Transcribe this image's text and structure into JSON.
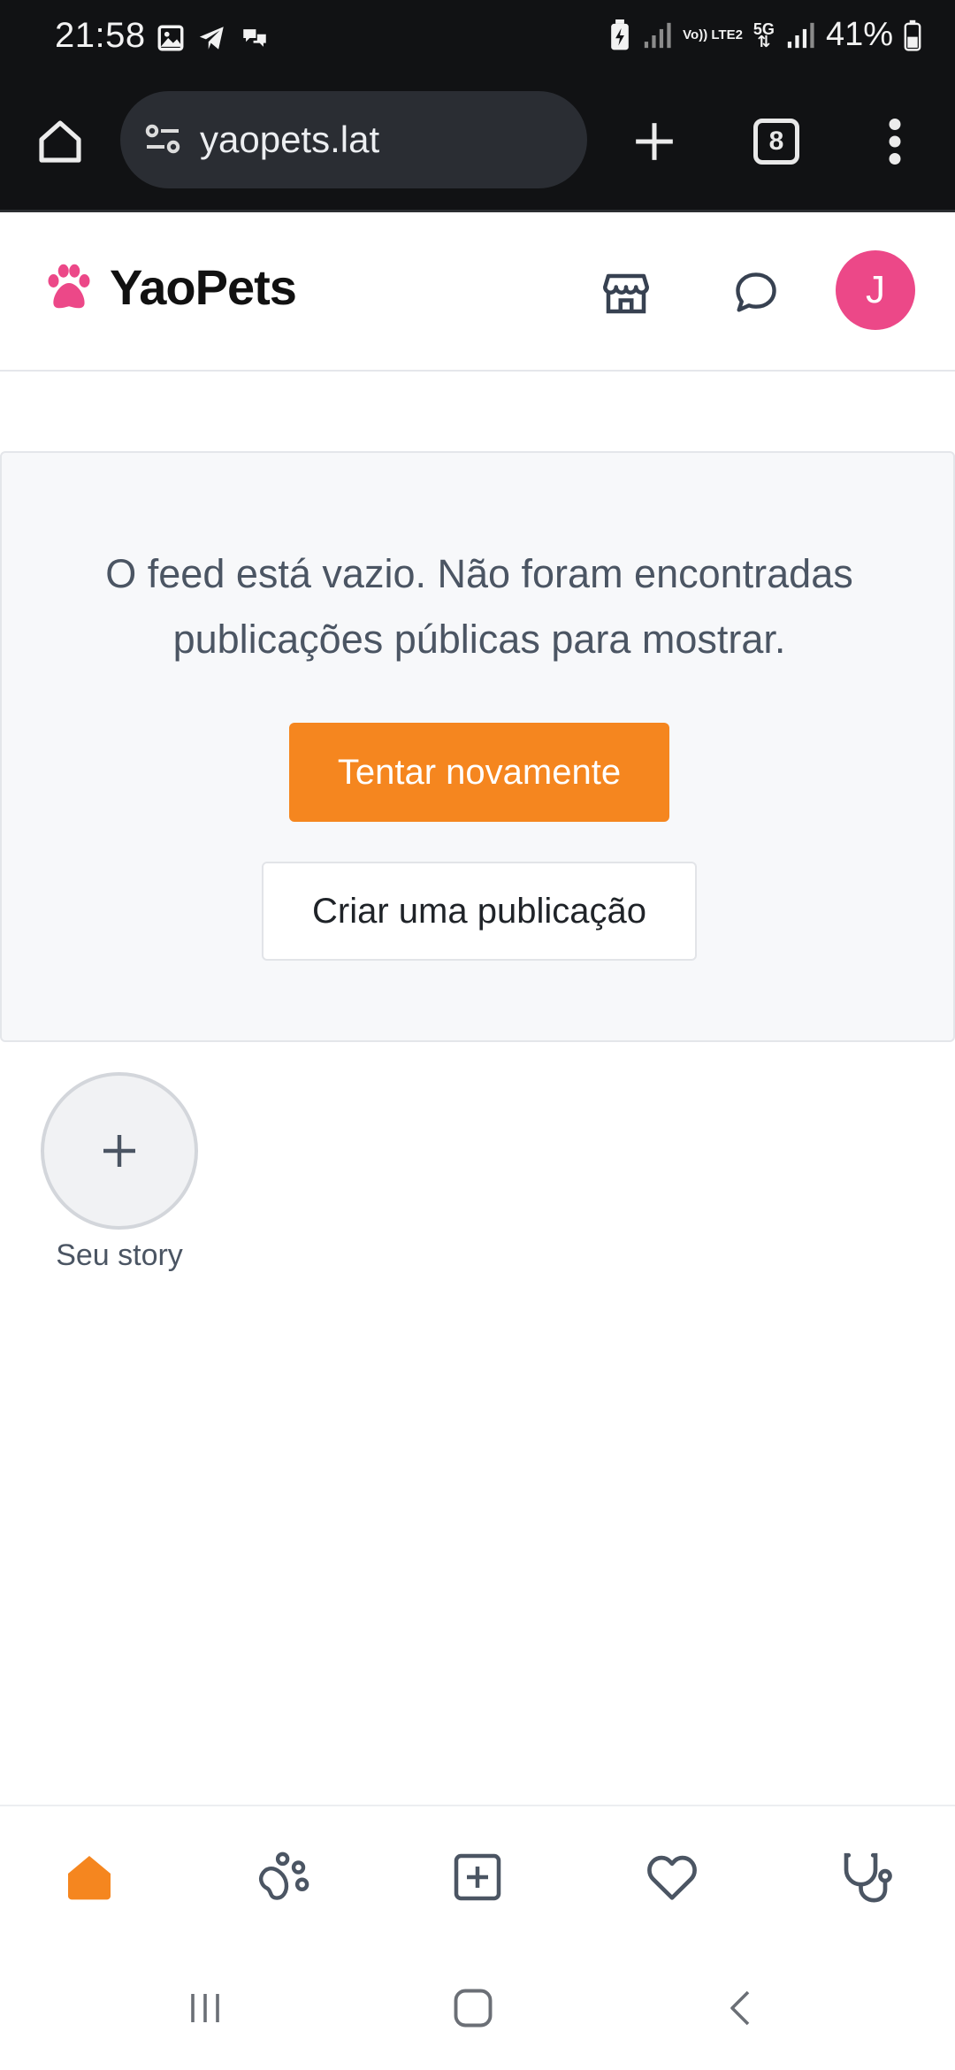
{
  "status_bar": {
    "time": "21:58",
    "network_lte": "Vo)) LTE2",
    "network_5g": "5G",
    "battery": "41%"
  },
  "browser": {
    "url": "yaopets.lat",
    "tab_count": "8"
  },
  "header": {
    "brand": "YaoPets",
    "avatar_initial": "J",
    "brand_color": "#ec4888"
  },
  "feed": {
    "empty_message": "O feed está vazio. Não foram encontradas publicações públicas para mostrar.",
    "retry_button": "Tentar novamente",
    "create_button": "Criar uma publicação",
    "accent_color": "#f5861f"
  },
  "stories": {
    "own_story_label": "Seu story"
  },
  "bottom_nav": {
    "items": [
      "home-icon",
      "paw-icon",
      "add-post-icon",
      "heart-icon",
      "stethoscope-icon"
    ],
    "active": "home-icon"
  }
}
